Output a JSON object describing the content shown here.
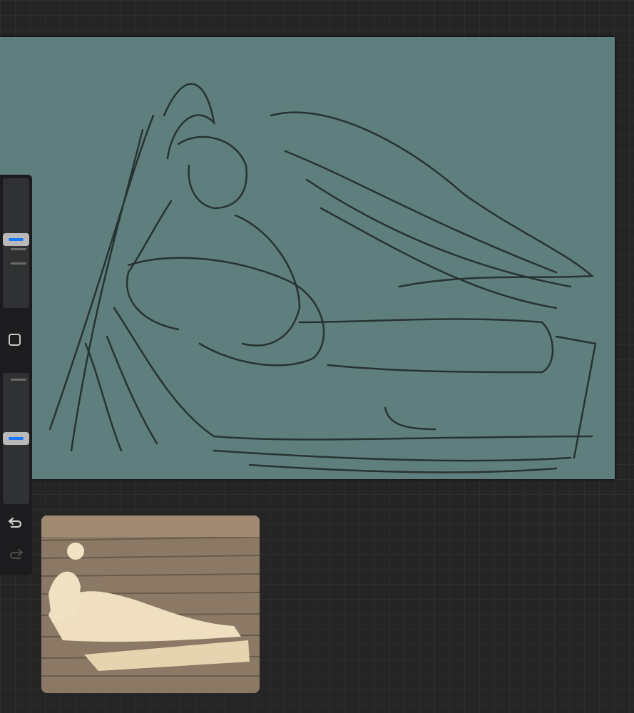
{
  "app": "Procreate",
  "colors": {
    "canvas": "#5e7f7e",
    "workspace": "#252525",
    "sidebar": "#1c1c1e",
    "slider_thumb_accent": "#1a78ff"
  },
  "sidebar": {
    "brush_size_slider": {
      "value_percent": 55
    },
    "modify_button": {
      "icon": "square-icon"
    },
    "opacity_slider": {
      "value_percent": 50
    },
    "undo": {
      "icon": "undo-arrow-icon"
    },
    "redo": {
      "icon": "redo-arrow-icon",
      "enabled": false
    }
  },
  "reference_window": {
    "content": "photo"
  }
}
